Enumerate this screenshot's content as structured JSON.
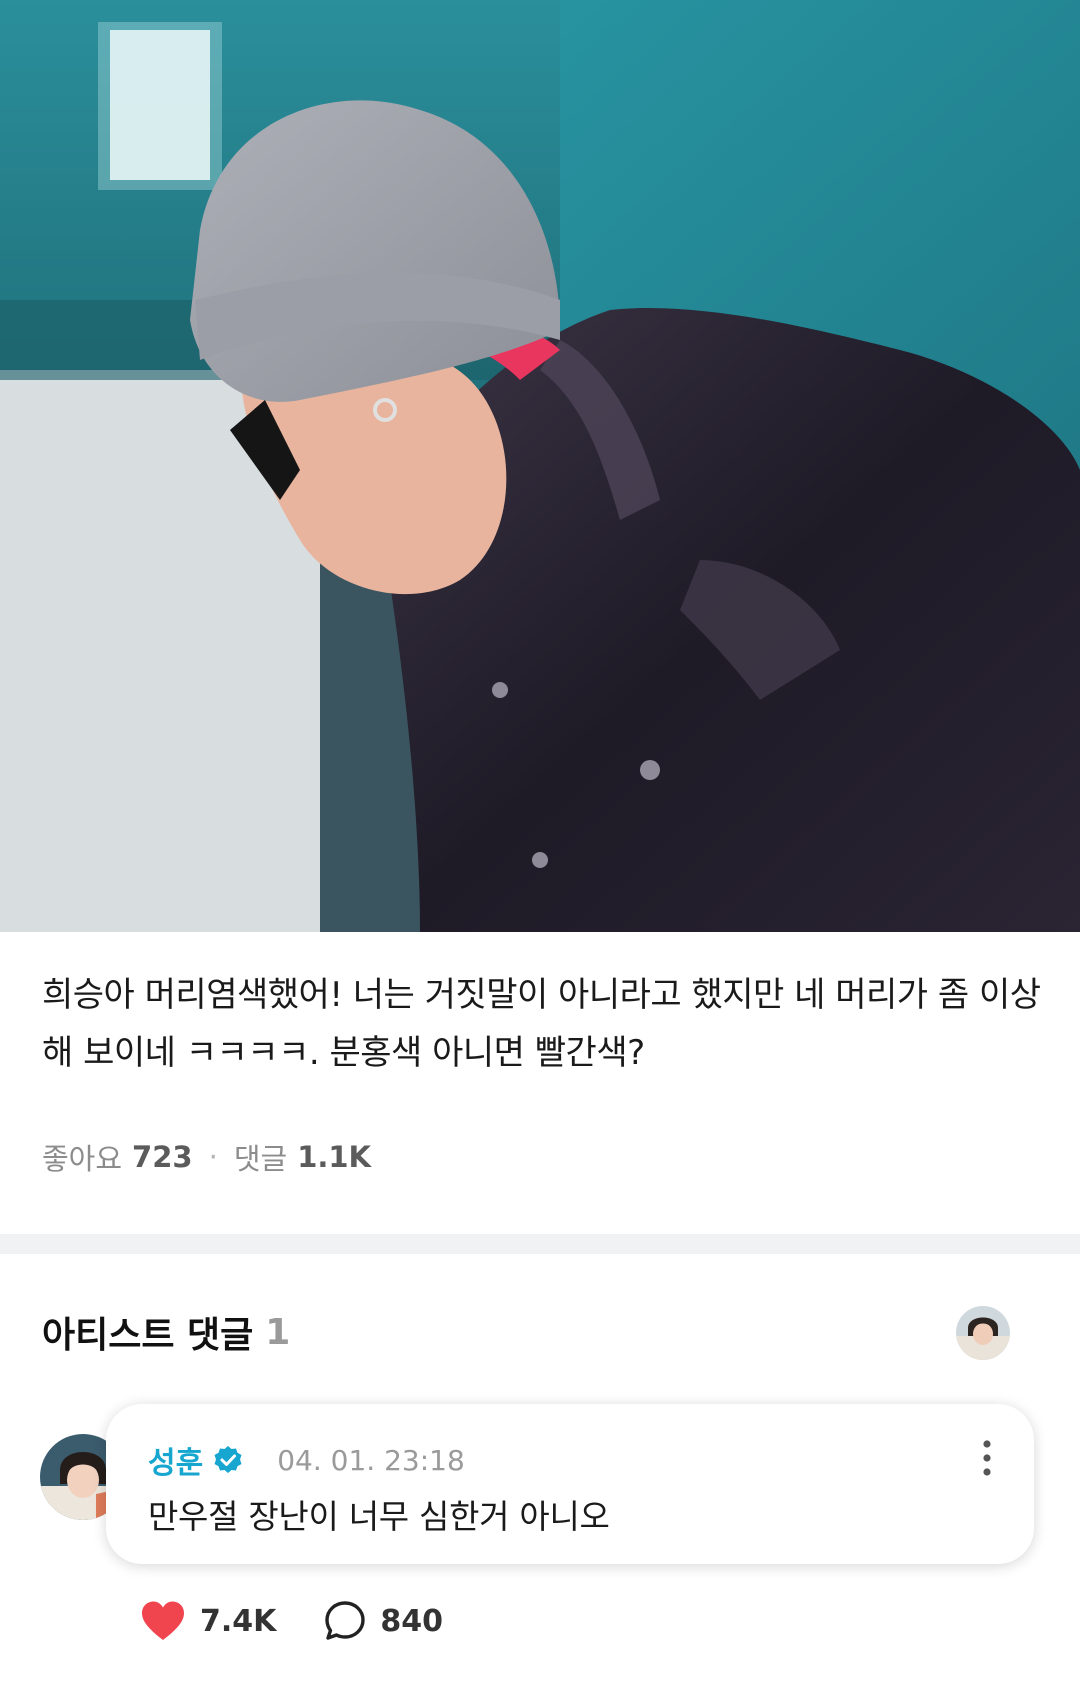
{
  "post": {
    "text": "희승아 머리염색했어! 너는 거짓말이 아니라고 했지만 네 머리가 좀 이상해 보이네 ㅋㅋㅋㅋ. 분홍색 아니면 빨간색?",
    "likes_label": "좋아요",
    "likes_count": "723",
    "comments_label": "댓글",
    "comments_count": "1.1K"
  },
  "artist_section": {
    "title": "아티스트 댓글",
    "count": "1"
  },
  "comment": {
    "author": "성훈",
    "timestamp": "04. 01. 23:18",
    "text": "만우절 장난이 너무 심한거 아니오",
    "like_count": "7.4K",
    "reply_count": "840"
  },
  "colors": {
    "accent": "#17a6cf",
    "heart": "#f0454f",
    "divider": "#f1f2f4"
  },
  "icons": [
    "verified-badge-icon",
    "more-vertical-icon",
    "heart-icon",
    "comment-bubble-icon"
  ]
}
